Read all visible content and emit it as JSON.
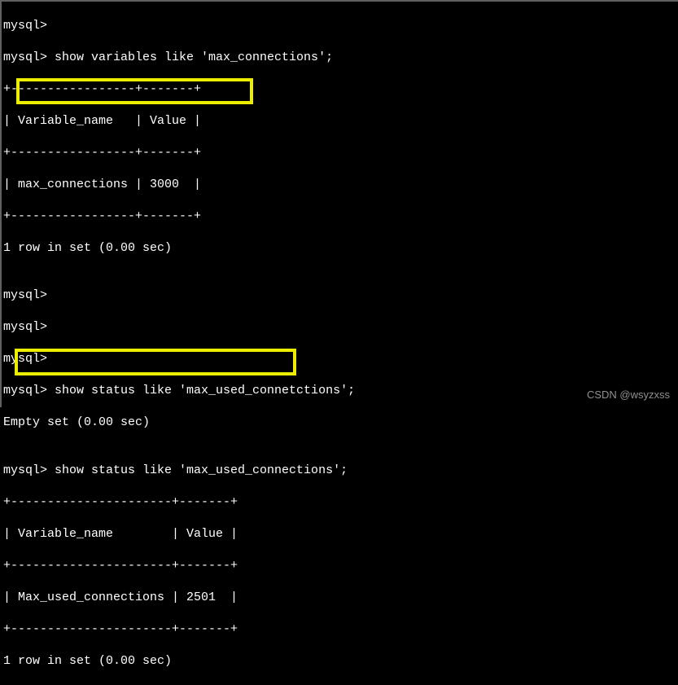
{
  "lines": {
    "l0": "mysql>",
    "l1": "mysql> show variables like 'max_connections';",
    "l2": "+-----------------+-------+",
    "l3": "| Variable_name   | Value |",
    "l4": "+-----------------+-------+",
    "l5": "| max_connections | 3000  |",
    "l6": "+-----------------+-------+",
    "l7": "1 row in set (0.00 sec)",
    "l8": "",
    "l9": "mysql>",
    "l10": "mysql>",
    "l11": "mysql>",
    "l12": "mysql> show status like 'max_used_connetctions';",
    "l13": "Empty set (0.00 sec)",
    "l14": "",
    "l15": "mysql> show status like 'max_used_connections';",
    "l16": "+----------------------+-------+",
    "l17": "| Variable_name        | Value |",
    "l18": "+----------------------+-------+",
    "l19": "| Max_used_connections | 2501  |",
    "l20": "+----------------------+-------+",
    "l21": "1 row in set (0.00 sec)"
  },
  "highlights": {
    "h1": {
      "variable": "max_connections",
      "value": "3000"
    },
    "h2": {
      "variable": "Max_used_connections",
      "value": "2501"
    }
  },
  "watermark": "CSDN @wsyzxss"
}
